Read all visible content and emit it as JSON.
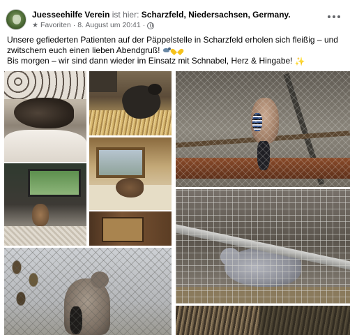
{
  "post": {
    "author": "Juesseehilfe Verein",
    "is_here_text": "ist hier:",
    "location": "Scharzfeld, Niedersachsen, Germany.",
    "audience_label": "Favoriten",
    "separator": "·",
    "timestamp": "8. August um 20:41",
    "separator2": "·",
    "audience_icon": "globe-icon",
    "text_line1": "Unsere gefiederten Patienten auf der Päppelstelle in Scharzfeld erholen sich fleißig – und zwitschern euch einen lieben Abendgruß!",
    "text_line2": "Bis morgen – wir sind dann wieder im Einsatz mit Schnabel, Herz & Hingabe!",
    "emoji_1": "bird-emoji",
    "emoji_2": "yellow-heart-emoji",
    "emoji_3": "sparkles-emoji"
  },
  "photos": [
    {
      "name": "photo-bird-in-blanket",
      "subject": "bird wrapped in blanket"
    },
    {
      "name": "photo-crow-on-hay",
      "subject": "crow sitting on hay"
    },
    {
      "name": "photo-bird-by-window",
      "subject": "small bird near window"
    },
    {
      "name": "photo-aviary-inside",
      "subject": "bird inside aviary"
    },
    {
      "name": "photo-wooden-box",
      "subject": "wooden box"
    },
    {
      "name": "photo-jay-on-perch",
      "subject": "jay on perch in enclosure"
    },
    {
      "name": "photo-pigeon-in-cage",
      "subject": "pigeon in wire cage"
    },
    {
      "name": "photo-dove-behind-net",
      "subject": "dove behind net"
    },
    {
      "name": "photo-hay-ground",
      "subject": "hay on ground"
    }
  ],
  "colors": {
    "text_primary": "#050505",
    "text_secondary": "#65676b",
    "background": "#ffffff"
  }
}
